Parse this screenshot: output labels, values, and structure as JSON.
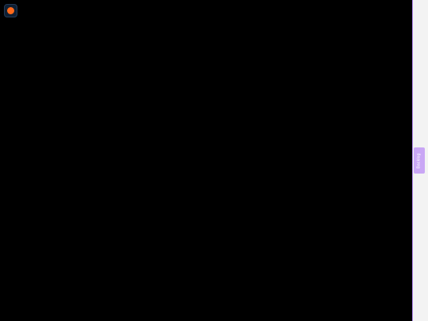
{
  "canvas": {
    "background": "#000000"
  },
  "record_button": {
    "icon": "record-dot-icon",
    "dot_color": "#ff6a1a"
  },
  "side_tab": {
    "label": "Backlog",
    "color": "#c9a6f5"
  }
}
